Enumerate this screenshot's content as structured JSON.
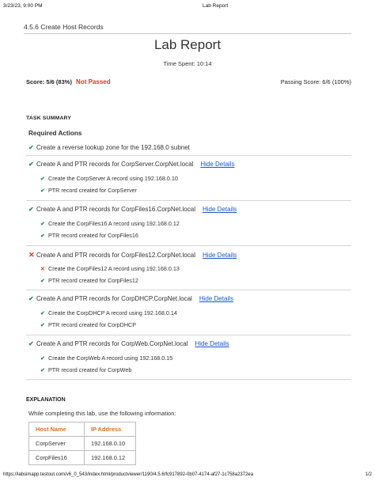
{
  "print_header": {
    "datetime": "3/23/23, 9:00 PM",
    "doc_title": "Lab Report"
  },
  "breadcrumb": "4.5.6 Create Host Records",
  "report": {
    "title": "Lab Report",
    "time_spent": "Time Spent: 10:14",
    "score": "Score: 5/6 (83%)",
    "status": "Not Passed",
    "passing_score": "Passing Score: 6/6 (100%)"
  },
  "task_summary": {
    "title": "TASK SUMMARY",
    "required_actions_label": "Required Actions",
    "hide_details_label": "Hide Details",
    "actions": [
      {
        "status": "pass",
        "label": "Create a reverse lookup zone for the 192.168.0 subnet",
        "details": []
      },
      {
        "status": "pass",
        "label": "Create A and PTR records for CorpServer.CorpNet.local",
        "details": [
          {
            "status": "pass",
            "label": "Create the CorpServer A record using 192.168.0.10"
          },
          {
            "status": "pass",
            "label": "PTR record created for CorpServer"
          }
        ]
      },
      {
        "status": "pass",
        "label": "Create A and PTR records for CorpFiles16.CorpNet.local",
        "details": [
          {
            "status": "pass",
            "label": "Create the CorpFiles16 A record using 192.168.0.12"
          },
          {
            "status": "pass",
            "label": "PTR record created for CorpFiles16"
          }
        ]
      },
      {
        "status": "fail",
        "label": "Create A and PTR records for CorpFiles12.CorpNet.local",
        "details": [
          {
            "status": "fail",
            "label": "Create the CorpFiles12 A record using 192.168.0.13"
          },
          {
            "status": "pass",
            "label": "PTR record created for CorpFiles12"
          }
        ]
      },
      {
        "status": "pass",
        "label": "Create A and PTR records for CorpDHCP.CorpNet.local",
        "details": [
          {
            "status": "pass",
            "label": "Create the CorpDHCP A record using 192.168.0.14"
          },
          {
            "status": "pass",
            "label": "PTR record created for CorpDHCP"
          }
        ]
      },
      {
        "status": "pass",
        "label": "Create A and PTR records for CorpWeb.CorpNet.local",
        "details": [
          {
            "status": "pass",
            "label": "Create the CorpWeb A record using 192.168.0.15"
          },
          {
            "status": "pass",
            "label": "PTR record created for CorpWeb"
          }
        ]
      }
    ]
  },
  "explanation": {
    "title": "EXPLANATION",
    "intro": "While completing this lab, use the following information:",
    "table": {
      "headers": [
        "Host Name",
        "IP Address"
      ],
      "rows": [
        [
          "CorpServer",
          "192.168.0.10"
        ],
        [
          "CorpFiles16",
          "192.168.0.12"
        ]
      ]
    }
  },
  "footer": {
    "url": "https://labsimapp.testout.com/v6_0_543/index.html/productviewer/1190/4.5.6/fc917892-0b07-4174-af27-1c758a2372ea",
    "page": "1/2"
  },
  "icons": {
    "pass": "check-icon",
    "fail": "cross-icon"
  },
  "colors": {
    "pass": "#2b8a5a",
    "fail": "#d9381e",
    "link": "#1a56c8",
    "table_header": "#e07020"
  }
}
